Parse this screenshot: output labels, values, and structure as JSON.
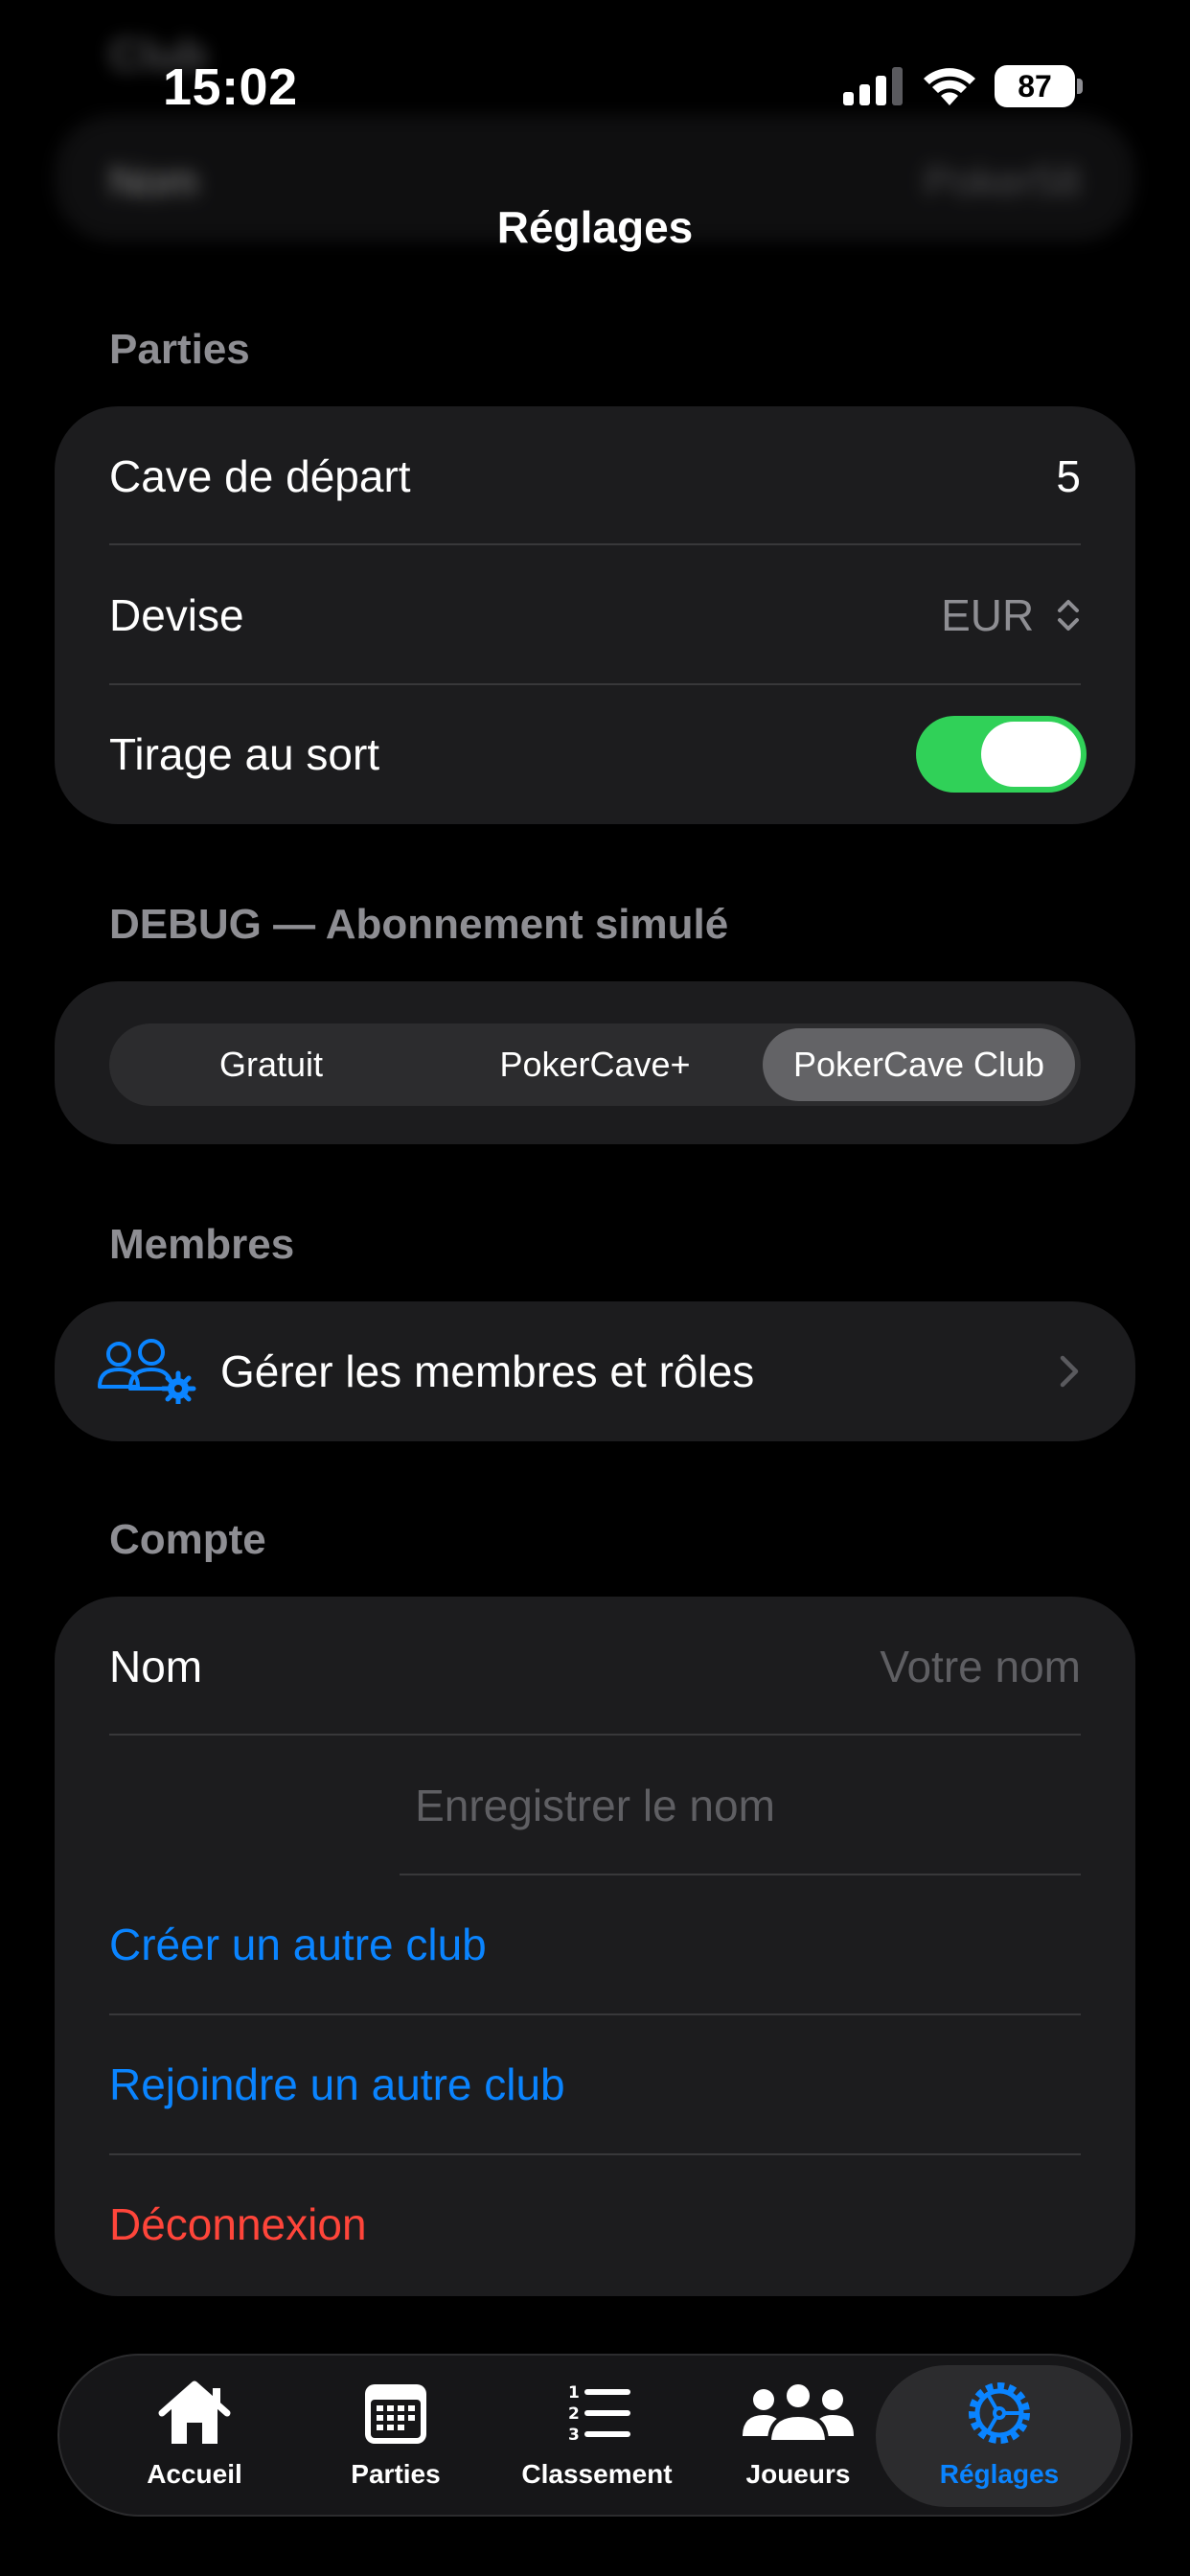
{
  "ghost_header": {
    "title": "Club",
    "row_label": "Nom",
    "row_value": "Poker58"
  },
  "status_bar": {
    "time": "15:02",
    "battery": "87"
  },
  "nav": {
    "title": "Réglages"
  },
  "parties": {
    "header": "Parties",
    "starting_cave_label": "Cave de départ",
    "starting_cave_value": "5",
    "currency_label": "Devise",
    "currency_value": "EUR",
    "draw_label": "Tirage au sort",
    "draw_enabled": true
  },
  "debug": {
    "header": "DEBUG — Abonnement simulé",
    "options": [
      "Gratuit",
      "PokerCave+",
      "PokerCave Club"
    ],
    "selected": "PokerCave Club"
  },
  "members": {
    "header": "Membres",
    "manage_label": "Gérer les membres et rôles"
  },
  "account": {
    "header": "Compte",
    "name_label": "Nom",
    "name_placeholder": "Votre nom",
    "save_name_label": "Enregistrer le nom",
    "create_club_label": "Créer un autre club",
    "join_club_label": "Rejoindre un autre club",
    "logout_label": "Déconnexion"
  },
  "tabs": [
    {
      "label": "Accueil",
      "icon": "house-icon"
    },
    {
      "label": "Parties",
      "icon": "calendar-icon"
    },
    {
      "label": "Classement",
      "icon": "list-number-icon"
    },
    {
      "label": "Joueurs",
      "icon": "people-icon"
    },
    {
      "label": "Réglages",
      "icon": "gear-icon",
      "active": true
    }
  ],
  "colors": {
    "accent": "#0a84ff",
    "toggle_on": "#30d158",
    "destructive": "#ff453a",
    "card": "#1c1c1e"
  }
}
